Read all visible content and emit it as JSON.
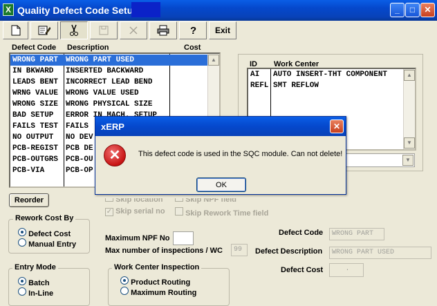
{
  "window": {
    "title": "Quality Defect Code Setup",
    "app_icon": "X",
    "controls": {
      "minimize": "_",
      "maximize": "□",
      "close": "✕"
    }
  },
  "toolbar": {
    "buttons": [
      {
        "name": "new",
        "icon": "new-document-icon"
      },
      {
        "name": "edit",
        "icon": "edit-icon"
      },
      {
        "name": "cut",
        "icon": "scissors-icon"
      },
      {
        "name": "save",
        "icon": "save-icon"
      },
      {
        "name": "delete",
        "icon": "delete-x-icon"
      },
      {
        "name": "print",
        "icon": "printer-icon"
      },
      {
        "name": "help",
        "icon": "help-question-icon"
      }
    ],
    "exit_label": "Exit"
  },
  "defect_list": {
    "headers": {
      "code": "Defect Code",
      "description": "Description",
      "cost": "Cost"
    },
    "rows": [
      {
        "code": "WRONG PART",
        "description": "WRONG PART USED",
        "cost": ""
      },
      {
        "code": "IN BKWARD",
        "description": "INSERTED BACKWARD",
        "cost": ""
      },
      {
        "code": "LEADS BENT",
        "description": "INCORRECT LEAD BEND",
        "cost": ""
      },
      {
        "code": "WRNG VALUE",
        "description": "WRONG VALUE USED",
        "cost": ""
      },
      {
        "code": "WRONG SIZE",
        "description": "WRONG PHYSICAL SIZE",
        "cost": ""
      },
      {
        "code": "BAD SETUP",
        "description": "ERROR IN MACH. SETUP",
        "cost": ""
      },
      {
        "code": "FAILS TEST",
        "description": "FAILS",
        "cost": ""
      },
      {
        "code": "NO OUTPUT",
        "description": "NO DEV",
        "cost": ""
      },
      {
        "code": "PCB-REGIST",
        "description": "PCB DE",
        "cost": ""
      },
      {
        "code": "PCB-OUTGRS",
        "description": "PCB-OU",
        "cost": ""
      },
      {
        "code": "PCB-VIA",
        "description": "PCB-OP",
        "cost": ""
      }
    ],
    "selected_index": 0
  },
  "work_center_list": {
    "headers": {
      "id": "ID",
      "name": "Work Center"
    },
    "rows": [
      {
        "id": "AI",
        "name": "AUTO INSERT-THT COMPONENT"
      },
      {
        "id": "REFL",
        "name": "SMT REFLOW"
      }
    ]
  },
  "reorder_label": "Reorder",
  "rework_cost_by": {
    "label": "Rework Cost By",
    "options": [
      "Defect Cost",
      "Manual Entry"
    ],
    "selected": "Defect Cost"
  },
  "entry_mode": {
    "label": "Entry Mode",
    "options": [
      "Batch",
      "In-Line"
    ],
    "selected": "Batch"
  },
  "work_center_inspection": {
    "label": "Work Center Inspection",
    "options": [
      "Product Routing",
      "Maximum Routing"
    ],
    "selected": "Product Routing"
  },
  "skip_options": {
    "skip_location": "Skip location",
    "skip_npf": "Skip NPF field",
    "skip_serial": "Skip serial no",
    "skip_rework_time": "Skip Rework Time field"
  },
  "max_npf": {
    "label": "Maximum NPF No",
    "value": ""
  },
  "max_inspections": {
    "label": "Max number of inspections / WC",
    "value": "99"
  },
  "detail": {
    "defect_code_label": "Defect Code",
    "defect_code_value": "WRONG PART",
    "defect_description_label": "Defect Description",
    "defect_description_value": "WRONG PART USED",
    "defect_cost_label": "Defect Cost",
    "defect_cost_value": "."
  },
  "dialog": {
    "title": "xERP",
    "message": "This defect code is used in the SQC module.  Can not delete!",
    "ok_label": "OK",
    "icon": "error-icon"
  }
}
